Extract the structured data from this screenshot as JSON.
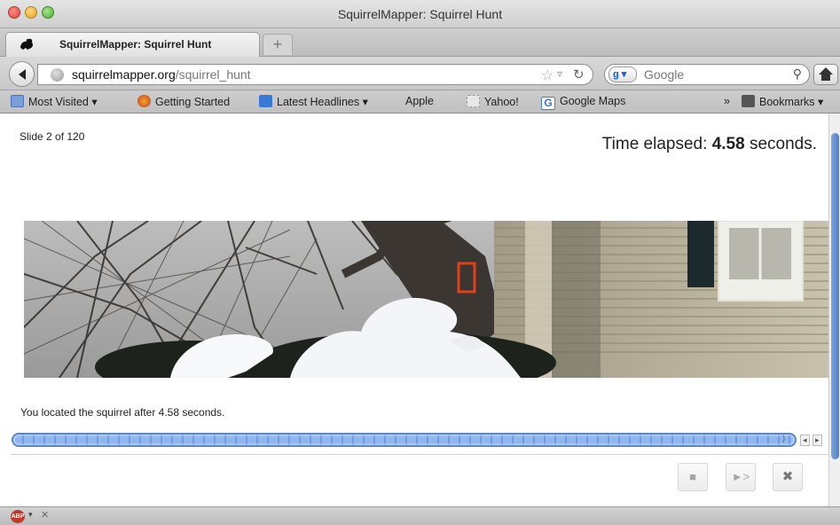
{
  "window": {
    "title": "SquirrelMapper: Squirrel Hunt"
  },
  "tab": {
    "label": "SquirrelMapper: Squirrel Hunt",
    "new_tab_label": "+"
  },
  "nav": {
    "url_host": "squirrelmapper.org",
    "url_path": "/squirrel_hunt",
    "search_placeholder": "Google",
    "search_engine_letter": "g"
  },
  "bookmarks": {
    "items": [
      {
        "label": "Most Visited",
        "icon": "folder-icon",
        "dropdown": "▾"
      },
      {
        "label": "Getting Started",
        "icon": "firefox-icon"
      },
      {
        "label": "Latest Headlines",
        "icon": "rss-icon",
        "dropdown": "▾"
      },
      {
        "label": "Apple",
        "icon": "apple-icon"
      },
      {
        "label": "Yahoo!",
        "icon": "blank-page-icon"
      },
      {
        "label": "Google Maps",
        "icon": "google-icon"
      }
    ],
    "overflow": "»",
    "bookmarks_menu": "Bookmarks",
    "bookmarks_menu_dropdown": "▾"
  },
  "page": {
    "slide_counter": "Slide 2 of 120",
    "timer_prefix": "Time elapsed: ",
    "timer_value": "4.58",
    "timer_suffix": " seconds.",
    "located_message": "You located the squirrel after 4.58 seconds.",
    "progress_fraction": 0.98
  },
  "controls": {
    "stop": "■",
    "next": "►>",
    "close": "✖"
  },
  "status": {
    "abp_label": "ABP",
    "abp_drop": "▾",
    "abp_close": "✕"
  },
  "colors": {
    "marker": "#e0401a",
    "progress": "#6f9be6"
  }
}
